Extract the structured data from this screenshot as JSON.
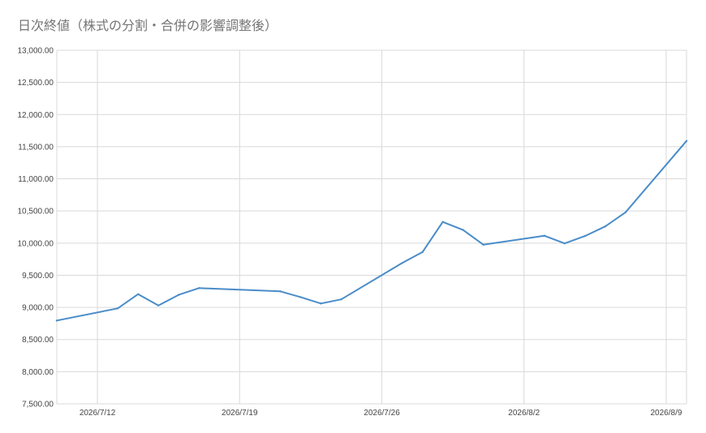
{
  "chart_data": {
    "type": "line",
    "title": "日次終値（株式の分割・合併の影響調整後）",
    "xlabel": "",
    "ylabel": "",
    "ylim": [
      7500,
      13000
    ],
    "xlim": [
      "2026-07-10",
      "2026-08-10"
    ],
    "y_ticks": [
      "7,500.00",
      "8,000.00",
      "8,500.00",
      "9,000.00",
      "9,500.00",
      "10,000.00",
      "10,500.00",
      "11,000.00",
      "11,500.00",
      "12,000.00",
      "12,500.00",
      "13,000.00"
    ],
    "x_ticks": [
      {
        "date": "2026-07-12",
        "label": "2026/7/12"
      },
      {
        "date": "2026-07-19",
        "label": "2026/7/19"
      },
      {
        "date": "2026-07-26",
        "label": "2026/7/26"
      },
      {
        "date": "2026-08-02",
        "label": "2026/8/2"
      },
      {
        "date": "2026-08-09",
        "label": "2026/8/9"
      }
    ],
    "grid": true,
    "legend": "none",
    "colors": {
      "line": "#4a8cc8",
      "grid": "#d9d9d9",
      "title": "#757575",
      "tick_text": "#444444"
    },
    "series": [
      {
        "points": [
          [
            "2026-07-10",
            8795
          ],
          [
            "2026-07-13",
            8985
          ],
          [
            "2026-07-14",
            9205
          ],
          [
            "2026-07-15",
            9030
          ],
          [
            "2026-07-16",
            9195
          ],
          [
            "2026-07-17",
            9300
          ],
          [
            "2026-07-21",
            9250
          ],
          [
            "2026-07-22",
            9160
          ],
          [
            "2026-07-23",
            9060
          ],
          [
            "2026-07-24",
            9125
          ],
          [
            "2026-07-27",
            9690
          ],
          [
            "2026-07-28",
            9860
          ],
          [
            "2026-07-29",
            10330
          ],
          [
            "2026-07-30",
            10205
          ],
          [
            "2026-07-31",
            9975
          ],
          [
            "2026-08-03",
            10115
          ],
          [
            "2026-08-04",
            9995
          ],
          [
            "2026-08-05",
            10110
          ],
          [
            "2026-08-06",
            10260
          ],
          [
            "2026-08-07",
            10480
          ],
          [
            "2026-08-10",
            11590
          ]
        ]
      }
    ]
  }
}
